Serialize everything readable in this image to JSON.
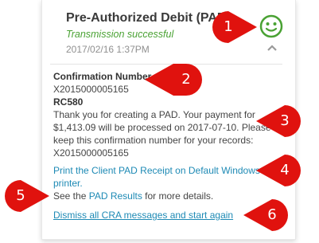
{
  "notification": {
    "title": "Pre-Authorized Debit (PAD",
    "status": "Transmission successful",
    "timestamp": "2017/02/16 1:37PM",
    "icon": "smiley-face-icon",
    "expand_icon": "chevron-up-icon",
    "status_color": "#4aa234"
  },
  "details": {
    "confirmation_label": "Confirmation Number",
    "confirmation_number": "X2015000005165",
    "code": "RC580",
    "message_lines": [
      "Thank you for creating a PAD. Your payment for",
      "$1,413.09 will be processed on 2017-07-10. Please",
      "keep this confirmation number for your records:",
      "X2015000005165"
    ],
    "print_link_lines": [
      "Print the Client PAD Receipt on Default Windows",
      "printer."
    ],
    "see_prefix": "See the ",
    "pad_results_link": "PAD Results",
    "see_suffix": " for more details.",
    "dismiss_link": "Dismiss all CRA messages and start again"
  },
  "callouts": [
    "1",
    "2",
    "3",
    "4",
    "5",
    "6"
  ],
  "callout_color": "#e0120e",
  "link_color": "#1e8ab5"
}
